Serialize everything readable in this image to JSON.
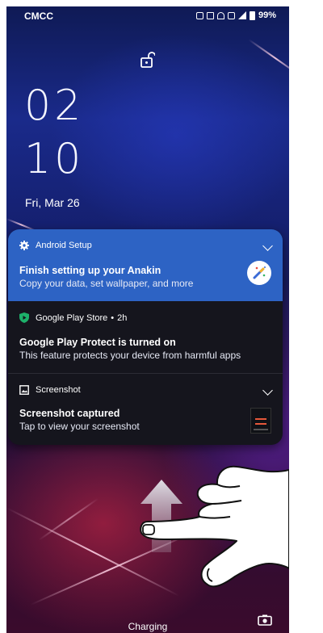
{
  "status_bar": {
    "carrier": "CMCC",
    "battery": "99%"
  },
  "lockscreen": {
    "hour": "02",
    "minute": "10",
    "date": "Fri, Mar 26"
  },
  "notifications": [
    {
      "app": "Android Setup",
      "title": "Finish setting up your Anakin",
      "text": "Copy your data, set wallpaper, and more",
      "accent": "#2d63c4"
    },
    {
      "app": "Google Play Store",
      "time": "2h",
      "title": "Google Play Protect is turned on",
      "text": "This feature protects your device from harmful apps",
      "icon_color": "#1db06a"
    },
    {
      "app": "Screenshot",
      "title": "Screenshot captured",
      "text": "Tap to view your screenshot"
    }
  ],
  "bottom": {
    "status": "Charging"
  },
  "icons": [
    "unlock-icon",
    "gear-icon",
    "chevron-down-icon",
    "magic-wand-icon",
    "shield-play-icon",
    "image-icon",
    "camera-icon",
    "swipe-up-arrow-icon",
    "hand-gesture-icon"
  ]
}
